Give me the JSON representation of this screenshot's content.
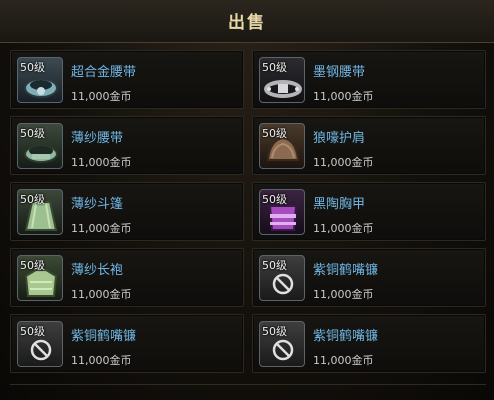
{
  "header": {
    "title": "出售"
  },
  "items": [
    {
      "level": "50级",
      "name": "超合金腰带",
      "price": "11,000金币",
      "icon": "alloy-belt-icon"
    },
    {
      "level": "50级",
      "name": "墨钢腰带",
      "price": "11,000金币",
      "icon": "ink-steel-belt-icon"
    },
    {
      "level": "50级",
      "name": "薄纱腰带",
      "price": "11,000金币",
      "icon": "gauze-belt-icon"
    },
    {
      "level": "50级",
      "name": "狼嚎护肩",
      "price": "11,000金币",
      "icon": "wolf-howl-shoulder-icon"
    },
    {
      "level": "50级",
      "name": "薄纱斗篷",
      "price": "11,000金币",
      "icon": "gauze-cloak-icon"
    },
    {
      "level": "50级",
      "name": "黑陶胸甲",
      "price": "11,000金币",
      "icon": "black-pottery-chest-icon"
    },
    {
      "level": "50级",
      "name": "薄纱长袍",
      "price": "11,000金币",
      "icon": "gauze-robe-icon"
    },
    {
      "level": "50级",
      "name": "紫铜鹤嘴镰",
      "price": "11,000金币",
      "icon": "restricted-icon"
    },
    {
      "level": "50级",
      "name": "紫铜鹤嘴镰",
      "price": "11,000金币",
      "icon": "restricted-icon"
    },
    {
      "level": "50级",
      "name": "紫铜鹤嘴镰",
      "price": "11,000金币",
      "icon": "restricted-icon"
    }
  ]
}
